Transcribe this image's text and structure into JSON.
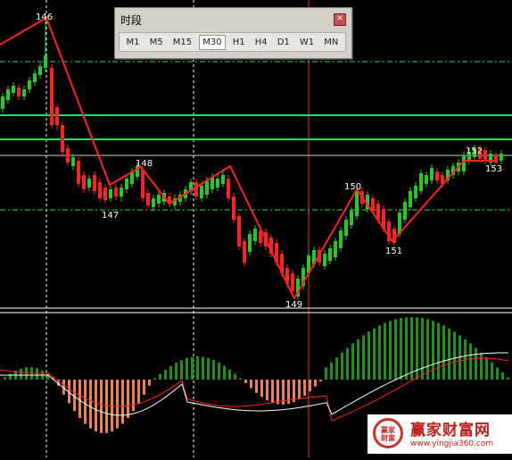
{
  "timeframe_panel": {
    "title": "时段",
    "close_icon": "close-icon",
    "options": [
      "M1",
      "M5",
      "M15",
      "M30",
      "H1",
      "H4",
      "D1",
      "W1",
      "MN"
    ],
    "selected": "M30"
  },
  "wave_labels": [
    "146",
    "147",
    "148",
    "149",
    "150",
    "151",
    "152",
    "153"
  ],
  "watermark": {
    "seal_text": "赢家\n财富",
    "name": "赢家财富网",
    "url": "www.yingjia360.com"
  },
  "colors": {
    "background": "#000000",
    "bull_candle": "#22cc22",
    "bear_candle": "#ff2020",
    "wave_line": "#ff2020",
    "green_level": "#22dd66",
    "vertical_marker": "#ff3030",
    "histogram_positive": "#1f8f1f",
    "histogram_negative": "#e8825a",
    "macd_line": "#ffffff",
    "signal_line": "#ff2020"
  },
  "chart_data": {
    "type": "candlestick",
    "wave_points": [
      {
        "label": "146",
        "value": 146
      },
      {
        "label": "147",
        "value": 147
      },
      {
        "label": "148",
        "value": 148
      },
      {
        "label": "149",
        "value": 149
      },
      {
        "label": "150",
        "value": 150
      },
      {
        "label": "151",
        "value": 151
      },
      {
        "label": "152",
        "value": 152
      },
      {
        "label": "153",
        "value": 153
      }
    ]
  }
}
